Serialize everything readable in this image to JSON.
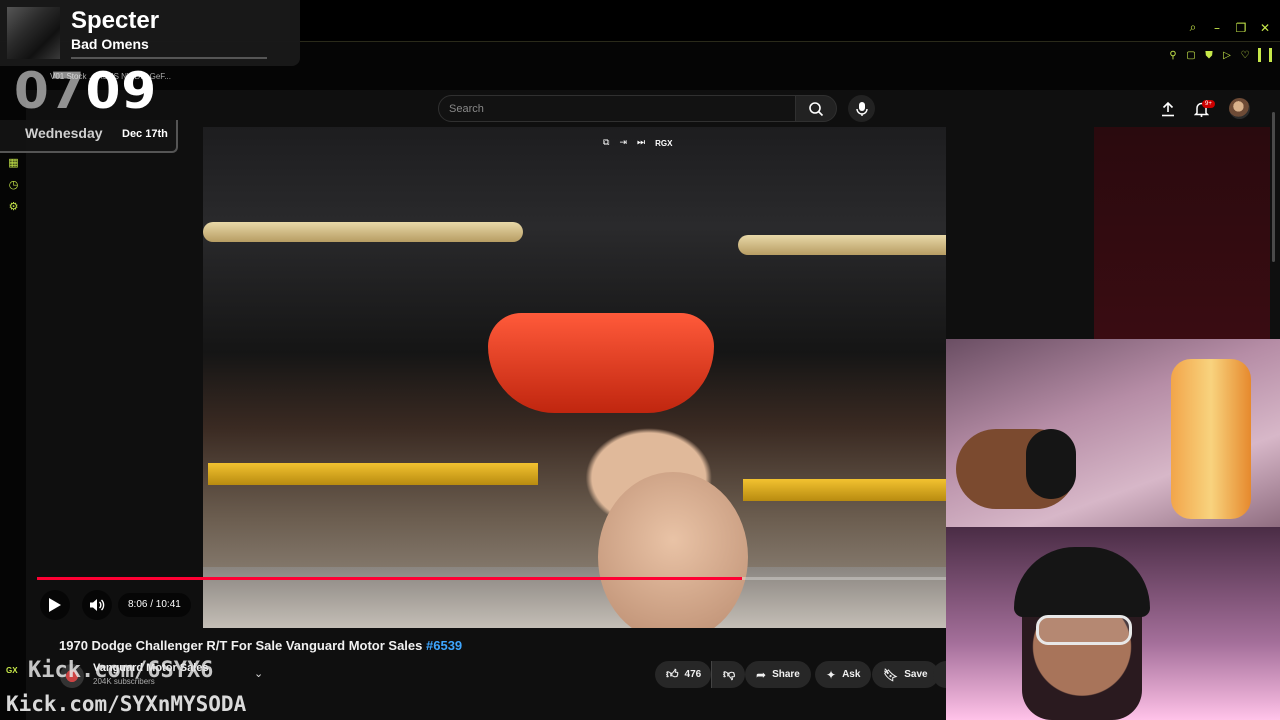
{
  "browser": {
    "tab_text": "V01 Stock ... ASUS NVIDIA GeF...",
    "gx_label": "GX"
  },
  "header": {
    "search_placeholder": "Search",
    "notification_count": "9+"
  },
  "video": {
    "overlay_label": "RGX",
    "current_time": "8:06",
    "duration": "10:41",
    "time_display": "8:06 / 10:41",
    "progress_fraction": 0.776,
    "title": "1970 Dodge Challenger R/T For Sale Vanguard Motor Sales",
    "title_tag": "#6539"
  },
  "channel": {
    "name": "Vanguard Motor Sales",
    "subscribers": "204K subscribers"
  },
  "actions": {
    "like_count": "476",
    "share_label": "Share",
    "ask_label": "Ask",
    "save_label": "Save"
  },
  "now_playing": {
    "title": "Specter",
    "artist": "Bad Omens"
  },
  "clock": {
    "hours": "07",
    "minutes": "09",
    "day": "Wednesday",
    "date": "Dec 17th"
  },
  "stream": {
    "kick_top": "Kick.com/6SYX6",
    "kick_bottom": "Kick.com/SYXnMYSODA"
  },
  "colors": {
    "accent": "#c7e84a",
    "progress": "#ff0033",
    "link": "#3ea6ff"
  }
}
